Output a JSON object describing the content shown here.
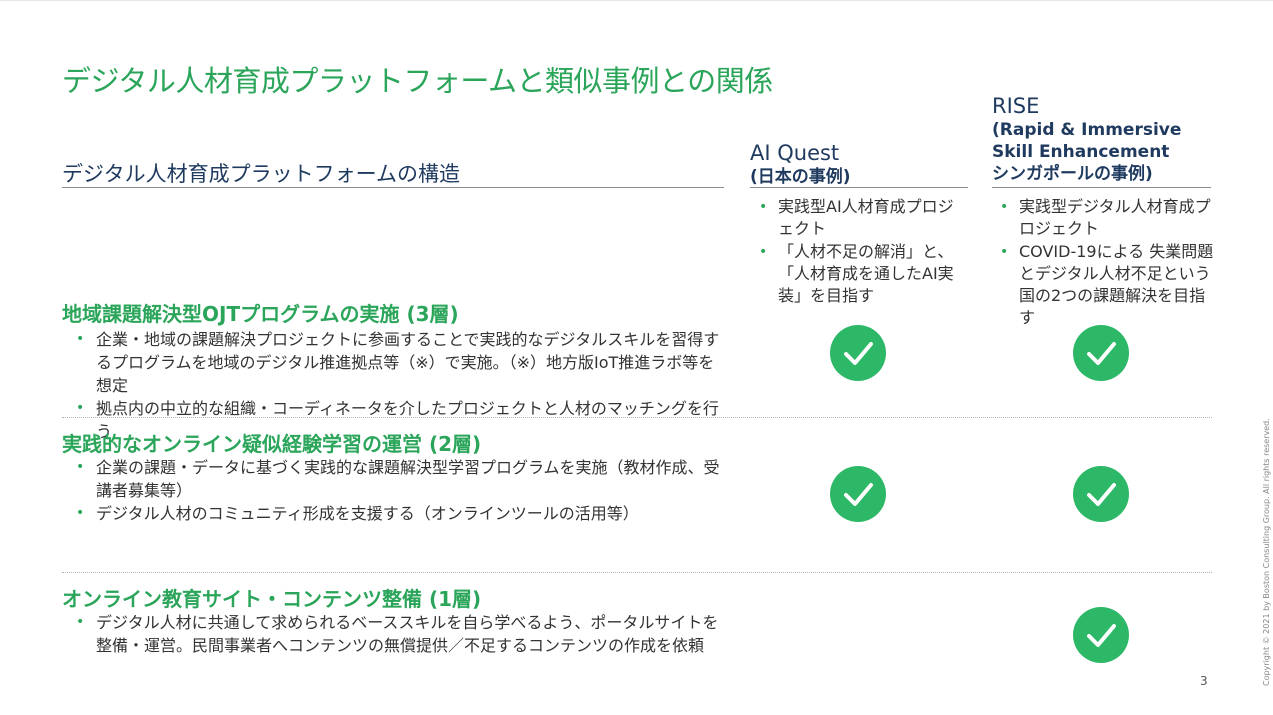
{
  "title": "デジタル人材育成プラットフォームと類似事例との関係",
  "structure_heading": "デジタル人材育成プラットフォームの構造",
  "columns": {
    "ai_quest": {
      "name": "AI Quest",
      "subtitle": "(日本の事例)",
      "bullets": [
        "実践型AI人材育成プロジェクト",
        "「人材不足の解消」と、「人材育成を通したAI実装」を目指す"
      ]
    },
    "rise": {
      "name": "RISE",
      "line2": "(Rapid & Immersive",
      "line3": "Skill Enhancement",
      "subtitle": "シンガポールの事例)",
      "bullets": [
        "実践型デジタル人材育成プロジェクト",
        "COVID-19による 失業問題とデジタル人材不足という国の2つの課題解決を目指す"
      ]
    }
  },
  "layers": [
    {
      "title": "地域課題解決型OJTプログラムの実施 (3層)",
      "bullets": [
        "企業・地域の課題解決プロジェクトに参画することで実践的なデジタルスキルを習得するプログラムを地域のデジタル推進拠点等（※）で実施。（※）地方版IoT推進ラボ等を想定",
        "拠点内の中立的な組織・コーディネータを介したプロジェクトと人材のマッチングを行う"
      ],
      "ai_quest": true,
      "rise": true
    },
    {
      "title": "実践的なオンライン疑似経験学習の運営 (2層)",
      "bullets": [
        "企業の課題・データに基づく実践的な課題解決型学習プログラムを実施（教材作成、受講者募集等）",
        "デジタル人材のコミュニティ形成を支援する（オンラインツールの活用等）"
      ],
      "ai_quest": true,
      "rise": true
    },
    {
      "title": "オンライン教育サイト・コンテンツ整備 (1層)",
      "bullets": [
        "デジタル人材に共通して求められるベーススキルを自ら学べるよう、ポータルサイトを整備・運営。民間事業者へコンテンツの無償提供／不足するコンテンツの作成を依頼"
      ],
      "ai_quest": false,
      "rise": true
    }
  ],
  "page_number": "3",
  "copyright": "Copyright © 2021 by Boston Consulting Group. All rights reserved.",
  "colors": {
    "accent_green": "#2aa55a",
    "check_green": "#2cb866",
    "navy": "#1f3a5f"
  },
  "icons": {
    "check": "check-circle-icon"
  }
}
